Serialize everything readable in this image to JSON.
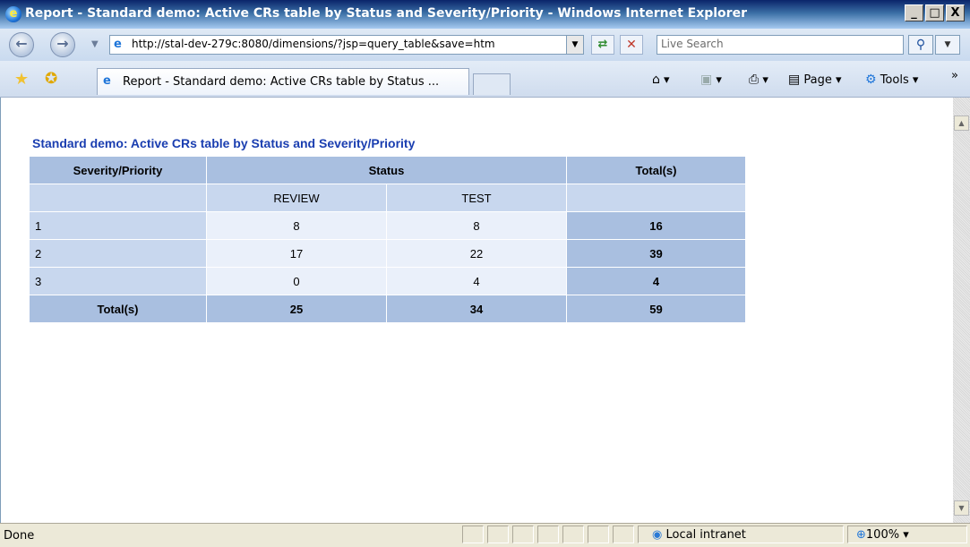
{
  "window": {
    "title": "Report - Standard demo: Active CRs table by Status and Severity/Priority - Windows Internet Explorer",
    "buttons": {
      "minimize": "_",
      "maximize": "□",
      "close": "X"
    }
  },
  "addressbar": {
    "url": "http://stal-dev-279c:8080/dimensions/?jsp=query_table&save=htm",
    "search_placeholder": "Live Search"
  },
  "tab": {
    "label": "Report - Standard demo: Active CRs table by Status ..."
  },
  "commands": {
    "page": "Page",
    "tools": "Tools"
  },
  "report": {
    "title": "Standard demo: Active CRs table by Status and Severity/Priority",
    "headers": {
      "severity_priority": "Severity/Priority",
      "status": "Status",
      "totals": "Total(s)"
    },
    "status_columns": [
      "REVIEW",
      "TEST"
    ],
    "rows": [
      {
        "label": "1",
        "review": "8",
        "test": "8",
        "total": "16"
      },
      {
        "label": "2",
        "review": "17",
        "test": "22",
        "total": "39"
      },
      {
        "label": "3",
        "review": "0",
        "test": "4",
        "total": "4"
      }
    ],
    "totals_row": {
      "label": "Total(s)",
      "review": "25",
      "test": "34",
      "total": "59"
    }
  },
  "statusbar": {
    "status": "Done",
    "zone": "Local intranet",
    "zoom": "100%"
  },
  "colors": {
    "header_bg": "#a9bfe0",
    "subheader_bg": "#c8d7ee",
    "cell_bg": "#eaf0fa",
    "title_color": "#1a3eb0"
  }
}
